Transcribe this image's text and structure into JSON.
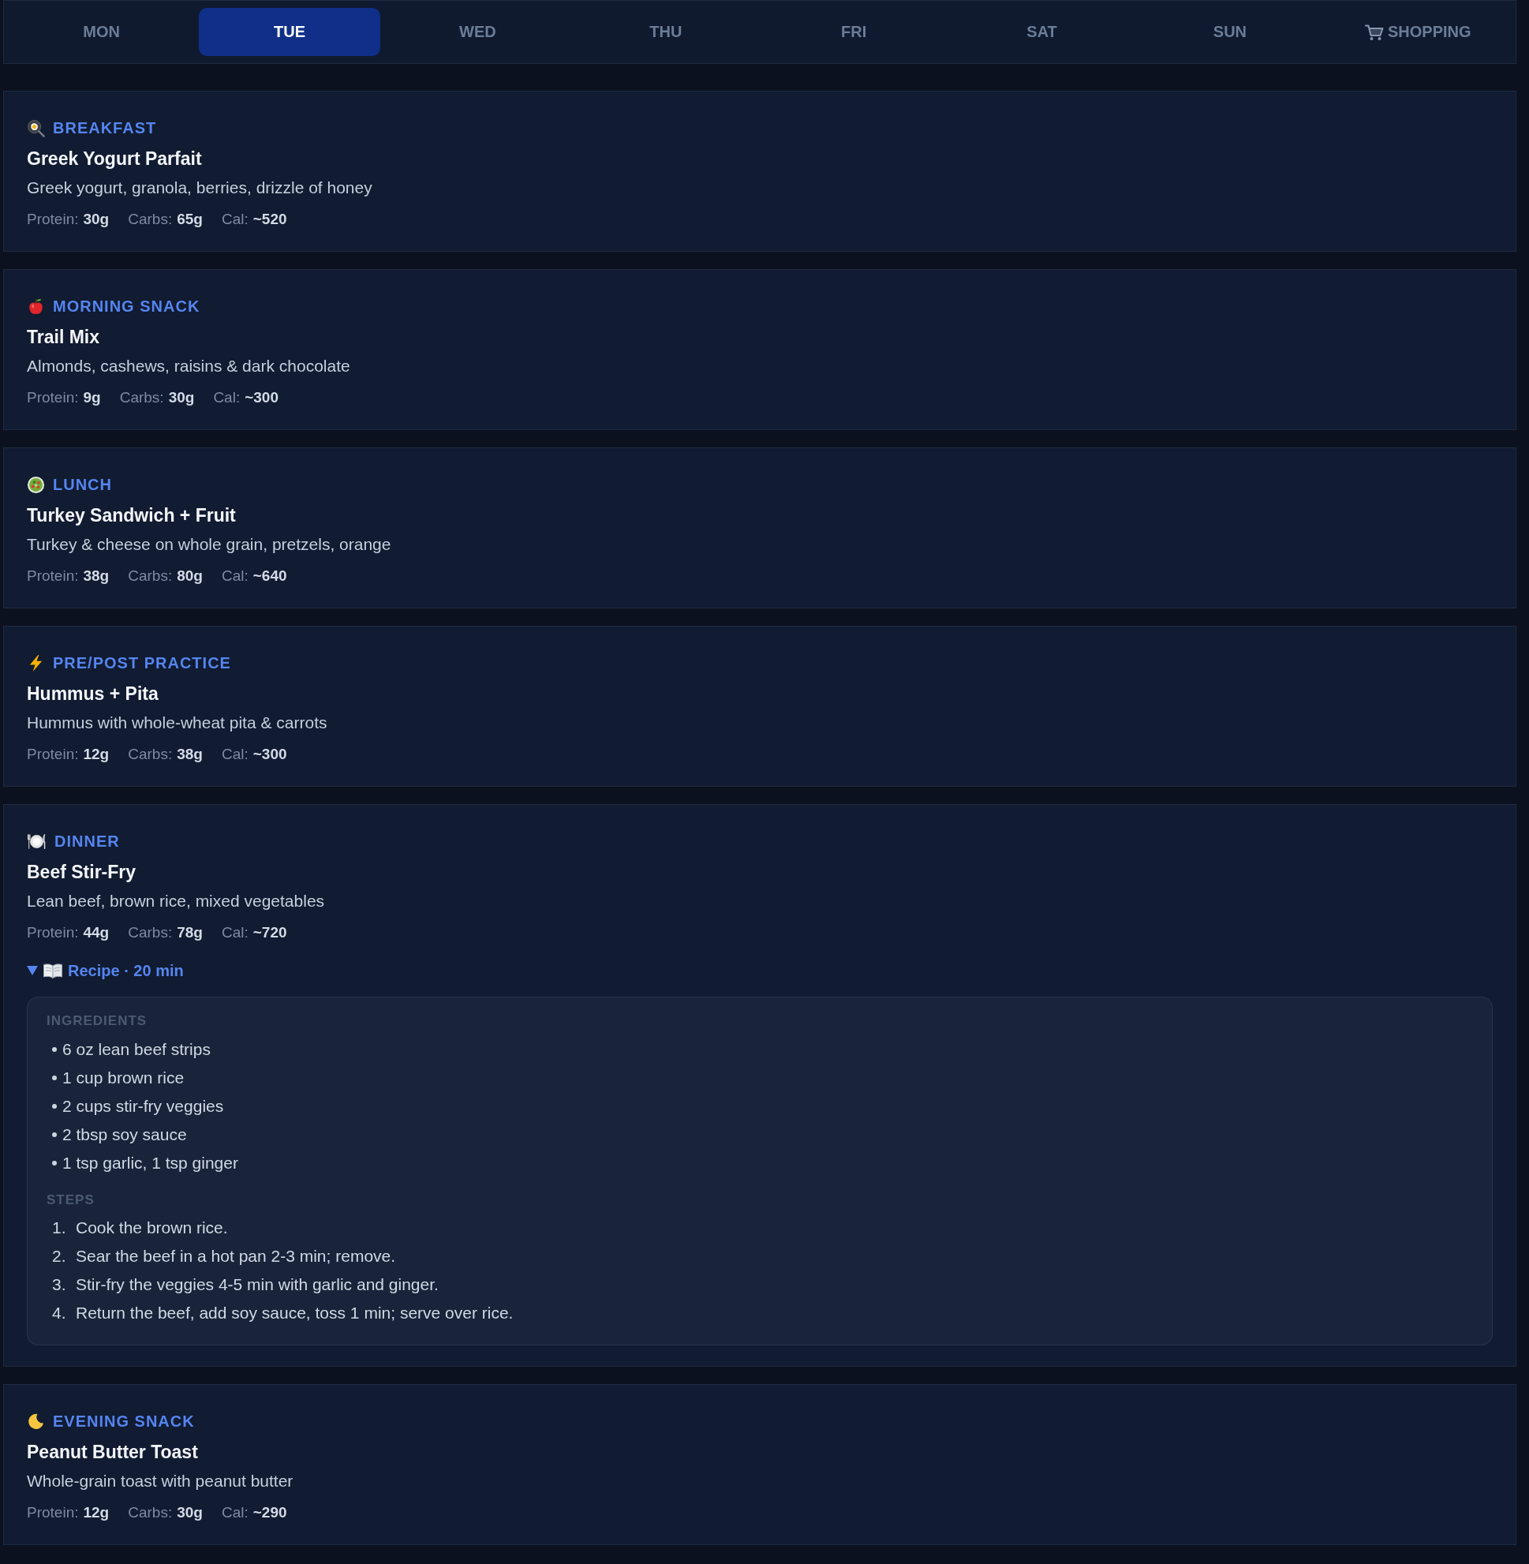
{
  "tabs": [
    {
      "label": "MON",
      "selected": false,
      "kind": "day"
    },
    {
      "label": "TUE",
      "selected": true,
      "kind": "day"
    },
    {
      "label": "WED",
      "selected": false,
      "kind": "day"
    },
    {
      "label": "THU",
      "selected": false,
      "kind": "day"
    },
    {
      "label": "FRI",
      "selected": false,
      "kind": "day"
    },
    {
      "label": "SAT",
      "selected": false,
      "kind": "day"
    },
    {
      "label": "SUN",
      "selected": false,
      "kind": "day"
    },
    {
      "label": "SHOPPING",
      "selected": false,
      "kind": "shopping"
    }
  ],
  "meals": [
    {
      "kind": "breakfast",
      "category": "BREAKFAST",
      "title": "Greek Yogurt Parfait",
      "description": "Greek yogurt, granola, berries, drizzle of honey",
      "macros": [
        {
          "label": "Protein:",
          "value": "30g"
        },
        {
          "label": "Carbs:",
          "value": "65g"
        },
        {
          "label": "Cal:",
          "value": "~520"
        }
      ]
    },
    {
      "kind": "snack",
      "category": "MORNING SNACK",
      "title": "Trail Mix",
      "description": "Almonds, cashews, raisins & dark chocolate",
      "macros": [
        {
          "label": "Protein:",
          "value": "9g"
        },
        {
          "label": "Carbs:",
          "value": "30g"
        },
        {
          "label": "Cal:",
          "value": "~300"
        }
      ]
    },
    {
      "kind": "lunch",
      "category": "LUNCH",
      "title": "Turkey Sandwich + Fruit",
      "description": "Turkey & cheese on whole grain, pretzels, orange",
      "macros": [
        {
          "label": "Protein:",
          "value": "38g"
        },
        {
          "label": "Carbs:",
          "value": "80g"
        },
        {
          "label": "Cal:",
          "value": "~640"
        }
      ]
    },
    {
      "kind": "practice",
      "category": "PRE/POST PRACTICE",
      "title": "Hummus + Pita",
      "description": "Hummus with whole-wheat pita & carrots",
      "macros": [
        {
          "label": "Protein:",
          "value": "12g"
        },
        {
          "label": "Carbs:",
          "value": "38g"
        },
        {
          "label": "Cal:",
          "value": "~300"
        }
      ]
    },
    {
      "kind": "dinner",
      "category": "DINNER",
      "title": "Beef Stir-Fry",
      "description": "Lean beef, brown rice, mixed vegetables",
      "macros": [
        {
          "label": "Protein:",
          "value": "44g"
        },
        {
          "label": "Carbs:",
          "value": "78g"
        },
        {
          "label": "Cal:",
          "value": "~720"
        }
      ],
      "recipe": {
        "expanded": true,
        "title": "Recipe · 20 min",
        "ingredients": {
          "heading": "INGREDIENTS",
          "items": [
            "6 oz lean beef strips",
            "1 cup brown rice",
            "2 cups stir-fry veggies",
            "2 tbsp soy sauce",
            "1 tsp garlic, 1 tsp ginger"
          ]
        },
        "steps": {
          "heading": "STEPS",
          "items": [
            {
              "number": "1.",
              "text": "Cook the brown rice."
            },
            {
              "number": "2.",
              "text": "Sear the beef in a hot pan 2-3 min; remove."
            },
            {
              "number": "3.",
              "text": "Stir-fry the veggies 4-5 min with garlic and ginger."
            },
            {
              "number": "4.",
              "text": "Return the beef, add soy sauce, toss 1 min; serve over rice."
            }
          ]
        }
      }
    },
    {
      "kind": "evening",
      "category": "EVENING SNACK",
      "title": "Peanut Butter Toast",
      "description": "Whole-grain toast with peanut butter",
      "macros": [
        {
          "label": "Protein:",
          "value": "12g"
        },
        {
          "label": "Carbs:",
          "value": "30g"
        },
        {
          "label": "Cal:",
          "value": "~290"
        }
      ]
    }
  ]
}
